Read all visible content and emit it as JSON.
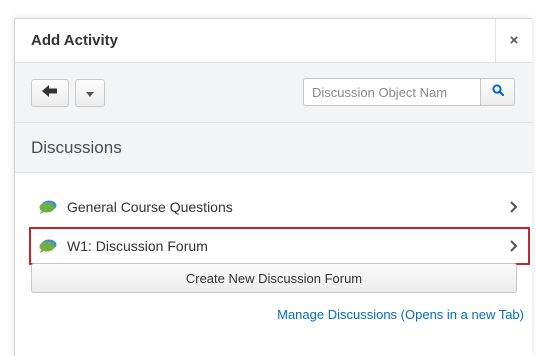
{
  "dialog": {
    "title": "Add Activity",
    "close_label": "×"
  },
  "toolbar": {
    "search_placeholder": "Discussion Object Nam"
  },
  "section": {
    "heading": "Discussions"
  },
  "items": [
    {
      "label": "General Course Questions",
      "highlighted": false
    },
    {
      "label": "W1: Discussion Forum",
      "highlighted": true
    }
  ],
  "actions": {
    "create_label": "Create New Discussion Forum",
    "manage_link": "Manage Discussions (Opens in a new Tab)"
  },
  "colors": {
    "link": "#006fbf",
    "highlight_border": "#c0272d",
    "icon_green": "#6dae45",
    "icon_blue": "#3f8ed6"
  },
  "icons": [
    "close-icon",
    "back-arrow-icon",
    "caret-down-icon",
    "search-icon",
    "discussion-icon",
    "chevron-right-icon"
  ]
}
